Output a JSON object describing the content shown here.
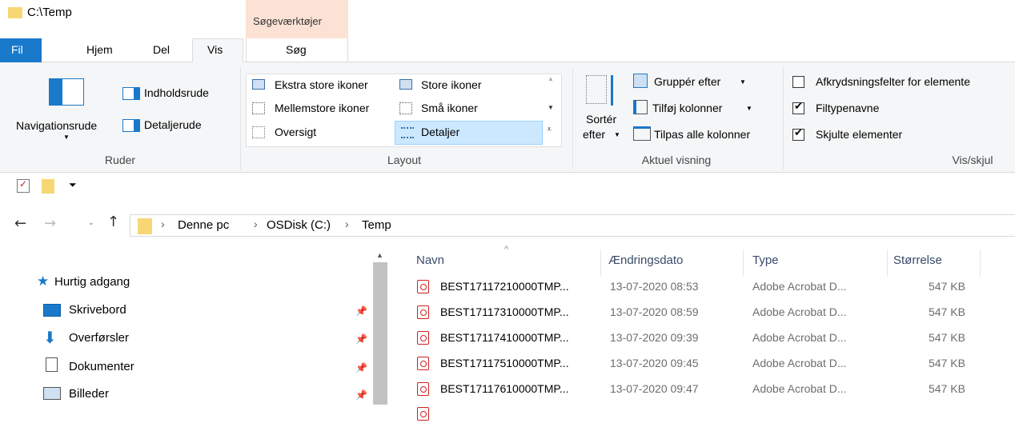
{
  "window": {
    "title": "C:\\Temp"
  },
  "contextual_tab": {
    "group_label": "Søgeværktøjer",
    "tab_label": "Søg"
  },
  "tabs": [
    {
      "label": "Fil"
    },
    {
      "label": "Hjem"
    },
    {
      "label": "Del"
    },
    {
      "label": "Vis"
    }
  ],
  "ribbon": {
    "ruder": {
      "label": "Ruder",
      "navigationsrude": "Navigationsrude",
      "indholdsrude": "Indholdsrude",
      "detaljerude": "Detaljerude"
    },
    "layout": {
      "label": "Layout",
      "items": [
        "Ekstra store ikoner",
        "Store ikoner",
        "Mellemstore ikoner",
        "Små ikoner",
        "Oversigt",
        "Detaljer"
      ],
      "selected": "Detaljer"
    },
    "aktuel": {
      "label": "Aktuel visning",
      "sort_line1": "Sortér",
      "sort_line2": "efter",
      "group_by": "Gruppér efter",
      "add_columns": "Tilføj kolonner",
      "fit_columns": "Tilpas alle kolonner"
    },
    "visskjul": {
      "label": "Vis/skjul",
      "options": [
        {
          "label": "Afkrydsningsfelter for elemente",
          "checked": false
        },
        {
          "label": "Filtypenavne",
          "checked": true
        },
        {
          "label": "Skjulte elementer",
          "checked": true
        }
      ]
    }
  },
  "address": {
    "path": [
      "Denne pc",
      "OSDisk (C:)",
      "Temp"
    ]
  },
  "nav": {
    "quick_access": "Hurtig adgang",
    "items": [
      {
        "label": "Skrivebord",
        "icon": "desktop-icon"
      },
      {
        "label": "Overførsler",
        "icon": "download-icon"
      },
      {
        "label": "Dokumenter",
        "icon": "document-icon"
      },
      {
        "label": "Billeder",
        "icon": "pictures-icon"
      }
    ]
  },
  "columns": {
    "name": "Navn",
    "date": "Ændringsdato",
    "type": "Type",
    "size": "Størrelse"
  },
  "files": [
    {
      "name": "BEST17117210000TMP...",
      "date": "13-07-2020 08:53",
      "type": "Adobe Acrobat D...",
      "size": "547 KB"
    },
    {
      "name": "BEST17117310000TMP...",
      "date": "13-07-2020 08:59",
      "type": "Adobe Acrobat D...",
      "size": "547 KB"
    },
    {
      "name": "BEST17117410000TMP...",
      "date": "13-07-2020 09:39",
      "type": "Adobe Acrobat D...",
      "size": "547 KB"
    },
    {
      "name": "BEST17117510000TMP...",
      "date": "13-07-2020 09:45",
      "type": "Adobe Acrobat D...",
      "size": "547 KB"
    },
    {
      "name": "BEST17117610000TMP...",
      "date": "13-07-2020 09:47",
      "type": "Adobe Acrobat D...",
      "size": "547 KB"
    }
  ],
  "colors": {
    "accent": "#1979ca",
    "contextual": "#fbe2d5",
    "folder": "#f7d674",
    "selected": "#cce8ff"
  }
}
